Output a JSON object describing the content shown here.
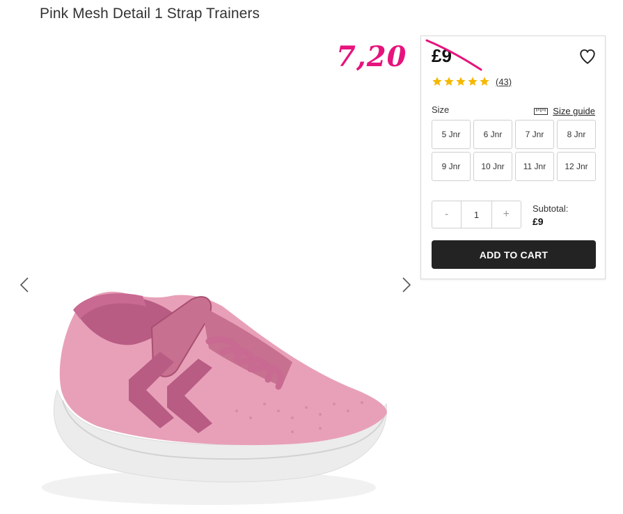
{
  "product": {
    "title": "Pink Mesh Detail 1 Strap Trainers"
  },
  "annotation": {
    "sale_price": "7,20"
  },
  "panel": {
    "price": "£9",
    "rating": {
      "stars": 5,
      "count_label": "(43)"
    },
    "size_label": "Size",
    "size_guide_label": "Size guide",
    "sizes": [
      "5 Jnr",
      "6 Jnr",
      "7 Jnr",
      "8 Jnr",
      "9 Jnr",
      "10 Jnr",
      "11 Jnr",
      "12 Jnr"
    ],
    "quantity": {
      "minus_label": "-",
      "value": "1",
      "plus_label": "+"
    },
    "subtotal_label": "Subtotal:",
    "subtotal_value": "£9",
    "add_to_cart_label": "ADD TO CART"
  },
  "colors": {
    "annotation_pink": "#e6137d",
    "star_gold": "#f5b800",
    "button_dark": "#232323"
  },
  "icons": {
    "prev": "chevron-left-icon",
    "next": "chevron-right-icon",
    "wishlist": "heart-icon",
    "size_guide": "ruler-icon",
    "rating": "star-icon"
  }
}
